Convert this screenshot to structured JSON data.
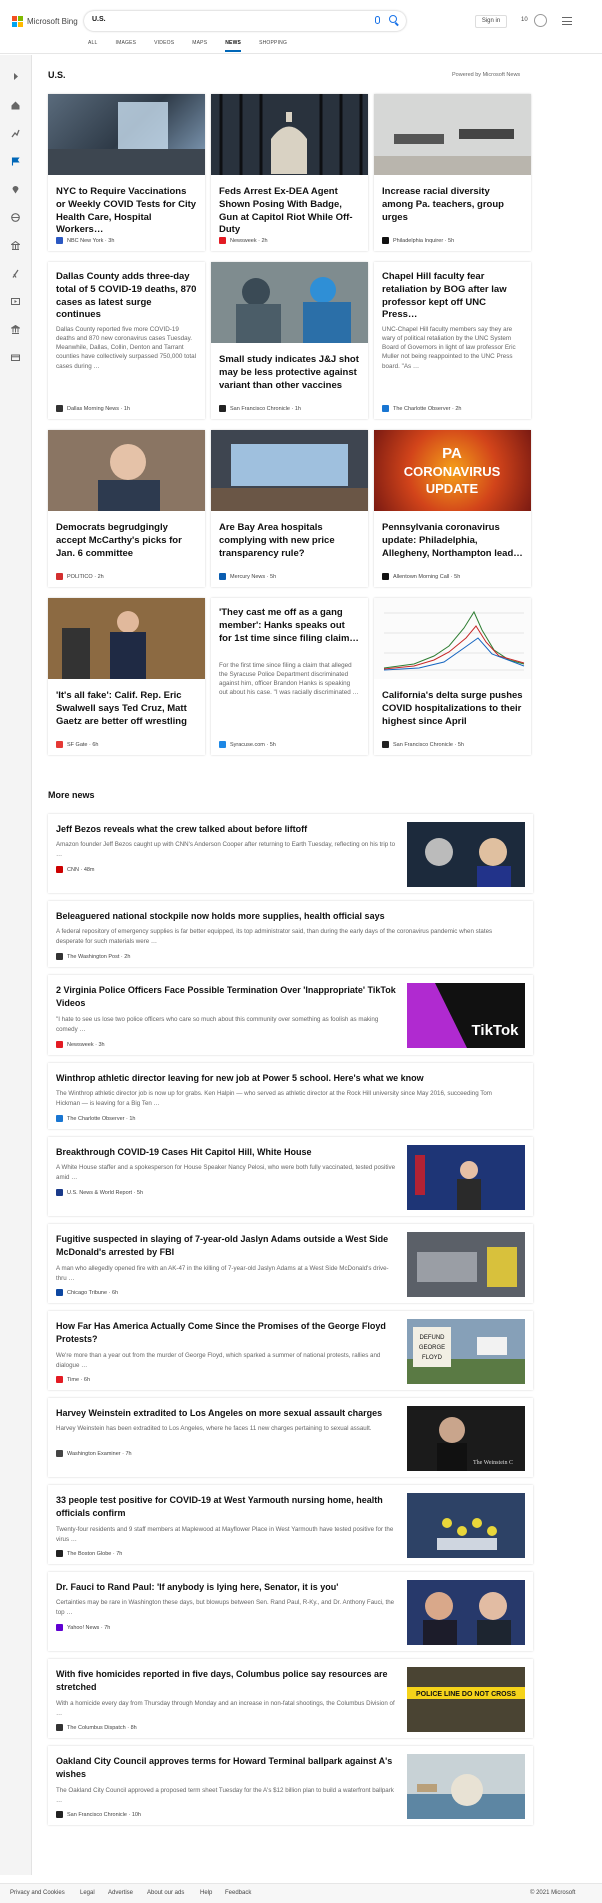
{
  "brand": "Microsoft Bing",
  "search": {
    "query": "U.S."
  },
  "header": {
    "sign_in": "Sign in",
    "points": "10"
  },
  "tabs": [
    "ALL",
    "IMAGES",
    "VIDEOS",
    "MAPS",
    "NEWS",
    "SHOPPING"
  ],
  "page": {
    "title": "U.S.",
    "powered_by": "Powered by Microsoft News",
    "more_news": "More news"
  },
  "cards": [
    {
      "title": "NYC to Require Vaccinations or Weekly COVID Tests for City Health Care, Hospital Workers…",
      "snippet": "",
      "source": "NBC New York",
      "time": "3h"
    },
    {
      "title": "Feds Arrest Ex-DEA Agent Shown Posing With Badge, Gun at Capitol Riot While Off-Duty",
      "snippet": "",
      "source": "Newsweek",
      "time": "2h"
    },
    {
      "title": "Increase racial diversity among Pa. teachers, group urges",
      "snippet": "",
      "source": "Philadelphia Inquirer",
      "time": "5h"
    },
    {
      "title": "Dallas County adds three-day total of 5 COVID-19 deaths, 870 cases as latest surge continues",
      "snippet": "Dallas County reported five more COVID-19 deaths and 870 new coronavirus cases Tuesday. Meanwhile, Dallas, Collin, Denton and Tarrant counties have collectively surpassed 750,000 total cases during …",
      "source": "Dallas Morning News",
      "time": "1h"
    },
    {
      "title": "Small study indicates J&J shot may be less protective against variant than other vaccines",
      "snippet": "",
      "source": "San Francisco Chronicle",
      "time": "1h"
    },
    {
      "title": "Chapel Hill faculty fear retaliation by BOG after law professor kept off UNC Press…",
      "snippet": "UNC-Chapel Hill faculty members say they are wary of political retaliation by the UNC System Board of Governors in light of law professor Eric Muller not being reappointed to the UNC Press board. \"As …",
      "source": "The Charlotte Observer",
      "time": "2h"
    },
    {
      "title": "Democrats begrudgingly accept McCarthy's picks for Jan. 6 committee",
      "snippet": "",
      "source": "POLITICO",
      "time": "2h"
    },
    {
      "title": "Are Bay Area hospitals complying with new price transparency rule?",
      "snippet": "",
      "source": "Mercury News",
      "time": "5h"
    },
    {
      "title": "Pennsylvania coronavirus update: Philadelphia, Allegheny, Northampton lead…",
      "snippet": "",
      "source": "Allentown Morning Call",
      "time": "5h",
      "img_text": [
        "PA",
        "CORONAVIRUS",
        "UPDATE"
      ]
    },
    {
      "title": "'It's all fake': Calif. Rep. Eric Swalwell says Ted Cruz, Matt Gaetz are better off wrestling",
      "snippet": "",
      "source": "SF Gate",
      "time": "6h"
    },
    {
      "title": "'They cast me off as a gang member': Hanks speaks out for 1st time since filing claim…",
      "snippet": "For the first time since filing a claim that alleged the Syracuse Police Department discriminated against him, officer Brandon Hanks is speaking out about his case. \"I was racially discriminated …",
      "source": "Syracuse.com",
      "time": "5h"
    },
    {
      "title": "California's delta surge pushes COVID hospitalizations to their highest since April",
      "snippet": "",
      "source": "San Francisco Chronicle",
      "time": "5h"
    }
  ],
  "more": [
    {
      "title": "Jeff Bezos reveals what the crew talked about before liftoff",
      "snippet": "Amazon founder Jeff Bezos caught up with CNN's Anderson Cooper after returning to Earth Tuesday, reflecting on his trip to …",
      "source": "CNN",
      "time": "48m"
    },
    {
      "title": "Beleaguered national stockpile now holds more supplies, health official says",
      "snippet": "A federal repository of emergency supplies is far better equipped, its top administrator said, than during the early days of the coronavirus pandemic when states desperate for such materials were …",
      "source": "The Washington Post",
      "time": "2h"
    },
    {
      "title": "2 Virginia Police Officers Face Possible Termination Over 'Inappropriate' TikTok Videos",
      "snippet": "\"I hate to see us lose two police officers who care so much about this community over something as foolish as making comedy …",
      "source": "Newsweek",
      "time": "3h",
      "img_text": "TikTok"
    },
    {
      "title": "Winthrop athletic director leaving for new job at Power 5 school. Here's what we know",
      "snippet": "The Winthrop athletic director job is now up for grabs. Ken Halpin — who served as athletic director at the Rock Hill university since May 2016, succeeding Tom Hickman — is leaving for a Big Ten …",
      "source": "The Charlotte Observer",
      "time": "1h"
    },
    {
      "title": "Breakthrough COVID-19 Cases Hit Capitol Hill, White House",
      "snippet": "A White House staffer and a spokesperson for House Speaker Nancy Pelosi, who were both fully vaccinated, tested positive amid …",
      "source": "U.S. News & World Report",
      "time": "5h"
    },
    {
      "title": "Fugitive suspected in slaying of 7-year-old Jaslyn Adams outside a West Side McDonald's arrested by FBI",
      "snippet": "A man who allegedly opened fire with an AK-47 in the killing of 7-year-old Jaslyn Adams at a West Side McDonald's drive-thru …",
      "source": "Chicago Tribune",
      "time": "6h"
    },
    {
      "title": "How Far Has America Actually Come Since the Promises of the George Floyd Protests?",
      "snippet": "We're more than a year out from the murder of George Floyd, which sparked a summer of national protests, rallies and dialogue …",
      "source": "Time",
      "time": "6h",
      "img_text": [
        "DEFUND",
        "GEORGE",
        "FLOYD"
      ]
    },
    {
      "title": "Harvey Weinstein extradited to Los Angeles on more sexual assault charges",
      "snippet": "Harvey Weinstein has been extradited to Los Angeles, where he faces 11 new charges pertaining to sexual assault.",
      "source": "Washington Examiner",
      "time": "7h",
      "img_text": "The Weinstein C"
    },
    {
      "title": "33 people test positive for COVID-19 at West Yarmouth nursing home, health officials confirm",
      "snippet": "Twenty-four residents and 9 staff members at Maplewood at Mayflower Place in West Yarmouth have tested positive for the virus …",
      "source": "The Boston Globe",
      "time": "7h"
    },
    {
      "title": "Dr. Fauci to Rand Paul: 'If anybody is lying here, Senator, it is you'",
      "snippet": "Certainties may be rare in Washington these days, but blowups between Sen. Rand Paul, R-Ky., and Dr. Anthony Fauci, the top …",
      "source": "Yahoo! News",
      "time": "7h"
    },
    {
      "title": "With five homicides reported in five days, Columbus police say resources are stretched",
      "snippet": "With a homicide every day from Thursday through Monday and an increase in non-fatal shootings, the Columbus Division of …",
      "source": "The Columbus Dispatch",
      "time": "8h",
      "img_text": "POLICE LINE DO NOT CROSS"
    },
    {
      "title": "Oakland City Council approves terms for Howard Terminal ballpark against A's wishes",
      "snippet": "The Oakland City Council approved a proposed term sheet Tuesday for the A's $12 billion plan to build a waterfront ballpark …",
      "source": "San Francisco Chronicle",
      "time": "10h"
    }
  ],
  "footer": {
    "links": [
      "Privacy and Cookies",
      "Legal",
      "Advertise",
      "About our ads",
      "Help",
      "Feedback"
    ],
    "copyright": "© 2021 Microsoft"
  },
  "colors": {
    "accent": "#0067b8",
    "search_icon": "#1a73e8",
    "rail": "#f4f4f4"
  }
}
